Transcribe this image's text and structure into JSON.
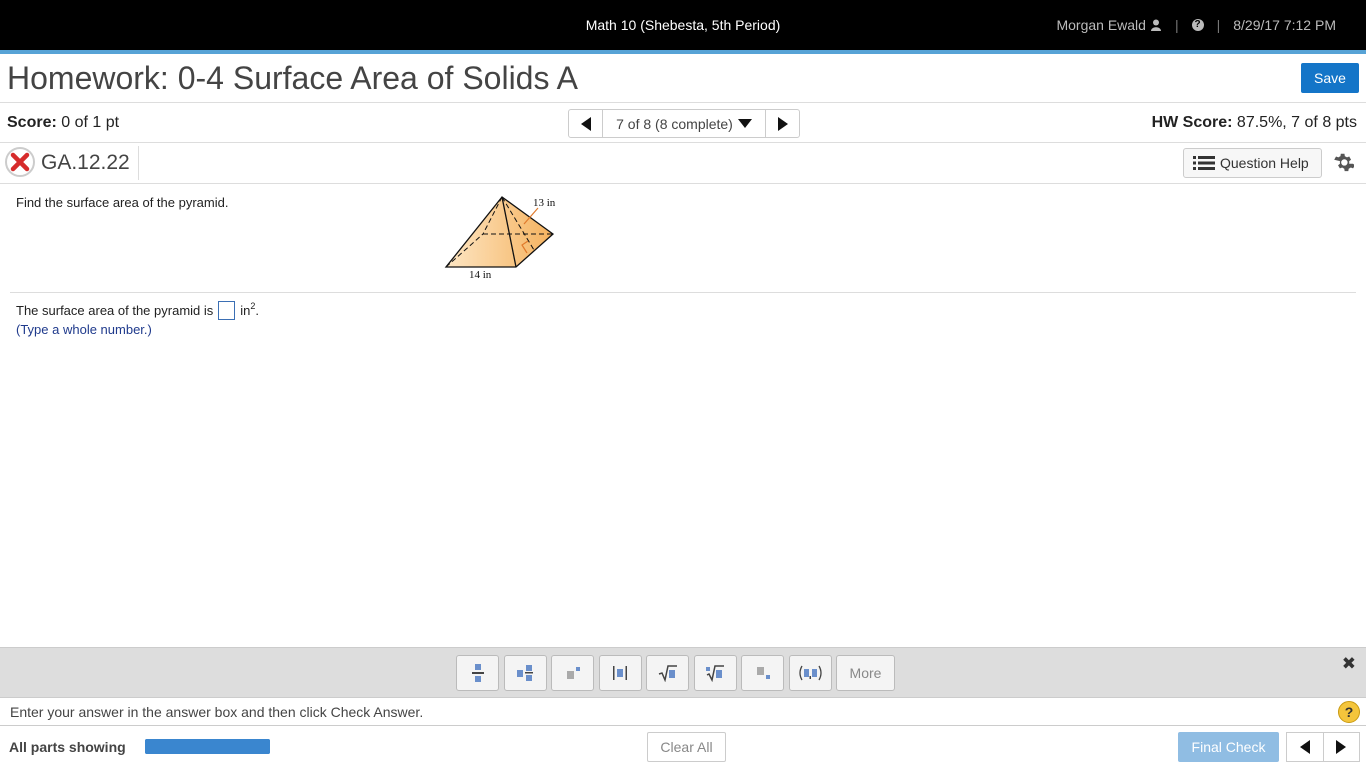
{
  "topbar": {
    "course": "Math 10 (Shebesta, 5th Period)",
    "user": "Morgan Ewald",
    "datetime": "8/29/17 7:12 PM"
  },
  "header": {
    "title": "Homework: 0-4 Surface Area of Solids A",
    "save_label": "Save"
  },
  "scorebar": {
    "score_label": "Score:",
    "score_value": "0 of 1 pt",
    "pager_text": "7 of 8 (8 complete)",
    "hw_score_label": "HW Score:",
    "hw_score_value": "87.5%, 7 of 8 pts"
  },
  "question": {
    "id": "GA.12.22",
    "help_label": "Question Help",
    "prompt": "Find the surface area of the pyramid.",
    "figure": {
      "slant_label": "13 in",
      "base_label": "14 in"
    },
    "answer_prefix": "The surface area of the pyramid is",
    "answer_value": "",
    "answer_unit": "in",
    "answer_exp": "2",
    "answer_suffix": ".",
    "hint": "(Type a whole number.)"
  },
  "toolbar": {
    "more_label": "More"
  },
  "status": {
    "message": "Enter your answer in the answer box and then click Check Answer.",
    "help_glyph": "?"
  },
  "footer": {
    "parts_label": "All parts showing",
    "progress": 1.0,
    "clear_label": "Clear All",
    "final_label": "Final Check"
  },
  "colors": {
    "accent": "#1475c8",
    "topline": "#57a3d6",
    "hint": "#1f3a8c",
    "pyramid_fill": "#f9c883"
  }
}
